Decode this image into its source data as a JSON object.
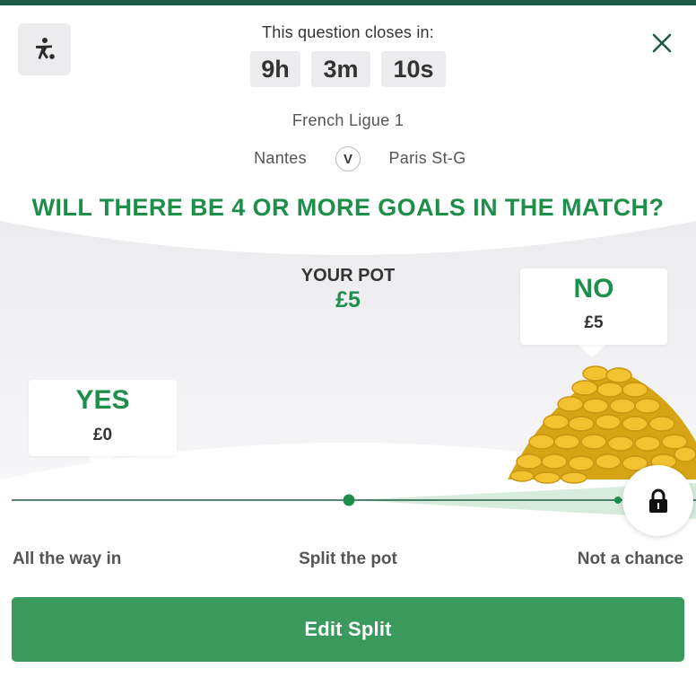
{
  "header": {
    "sport_icon": "football-player-icon",
    "close_icon": "close-icon",
    "closes_label": "This question closes in:",
    "countdown": {
      "hours": "9h",
      "minutes": "3m",
      "seconds": "10s"
    }
  },
  "match": {
    "league": "French Ligue 1",
    "home_team": "Nantes",
    "vs": "V",
    "away_team": "Paris St-G"
  },
  "question": "WILL THERE BE 4 OR MORE GOALS IN THE MATCH?",
  "pot": {
    "label": "YOUR POT",
    "value": "£5"
  },
  "options": {
    "yes": {
      "label": "YES",
      "amount": "£0"
    },
    "no": {
      "label": "NO",
      "amount": "£5"
    }
  },
  "slider": {
    "left_label": "All the way in",
    "middle_label": "Split the pot",
    "right_label": "Not a chance",
    "position_fraction": 1.0,
    "locked": true,
    "knob_icon": "lock-icon"
  },
  "actions": {
    "edit_split": "Edit Split"
  },
  "colors": {
    "accent_green": "#1e8f4a",
    "button_green": "#3a9a5b",
    "dark_green": "#1f5a44",
    "coin_gold": "#f2c230"
  }
}
